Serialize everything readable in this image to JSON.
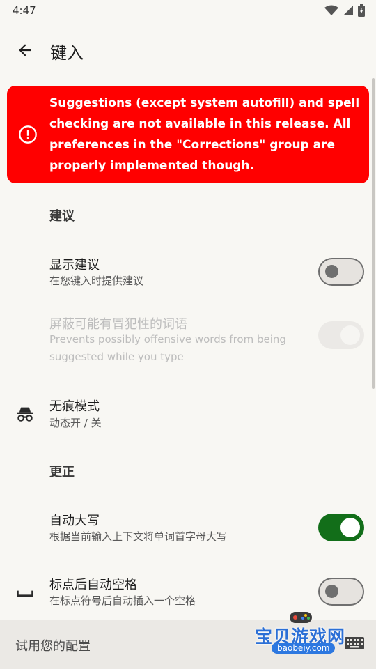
{
  "status_bar": {
    "time": "4:47"
  },
  "app_bar": {
    "title": "键入"
  },
  "banner": {
    "text": "Suggestions (except system autofill) and spell checking are not available in this release. All preferences in the \"Corrections\" group are properly implemented though."
  },
  "sections": {
    "suggestions": "建议",
    "corrections": "更正"
  },
  "rows": {
    "show_suggestions": {
      "title": "显示建议",
      "subtitle": "在您键入时提供建议",
      "checked": false
    },
    "block_offensive": {
      "title": "屏蔽可能有冒犯性的词语",
      "subtitle": "Prevents possibly offensive words from being suggested while you type",
      "checked": true,
      "enabled": false
    },
    "incognito": {
      "title": "无痕模式",
      "subtitle": "动态开 / 关",
      "icon": "incognito-icon"
    },
    "auto_capitalize": {
      "title": "自动大写",
      "subtitle": "根据当前输入上下文将单词首字母大写",
      "checked": true
    },
    "auto_space": {
      "title": "标点后自动空格",
      "subtitle": "在标点符号后自动插入一个空格",
      "checked": false,
      "icon": "space-bar-icon"
    }
  },
  "bottom_bar": {
    "placeholder": "试用您的配置"
  },
  "watermark": {
    "brand": "宝贝游戏网",
    "url": "baobeiy.com"
  },
  "colors": {
    "banner_bg": "#ff0000",
    "switch_on": "#126e19",
    "background": "#f8f7f3"
  }
}
